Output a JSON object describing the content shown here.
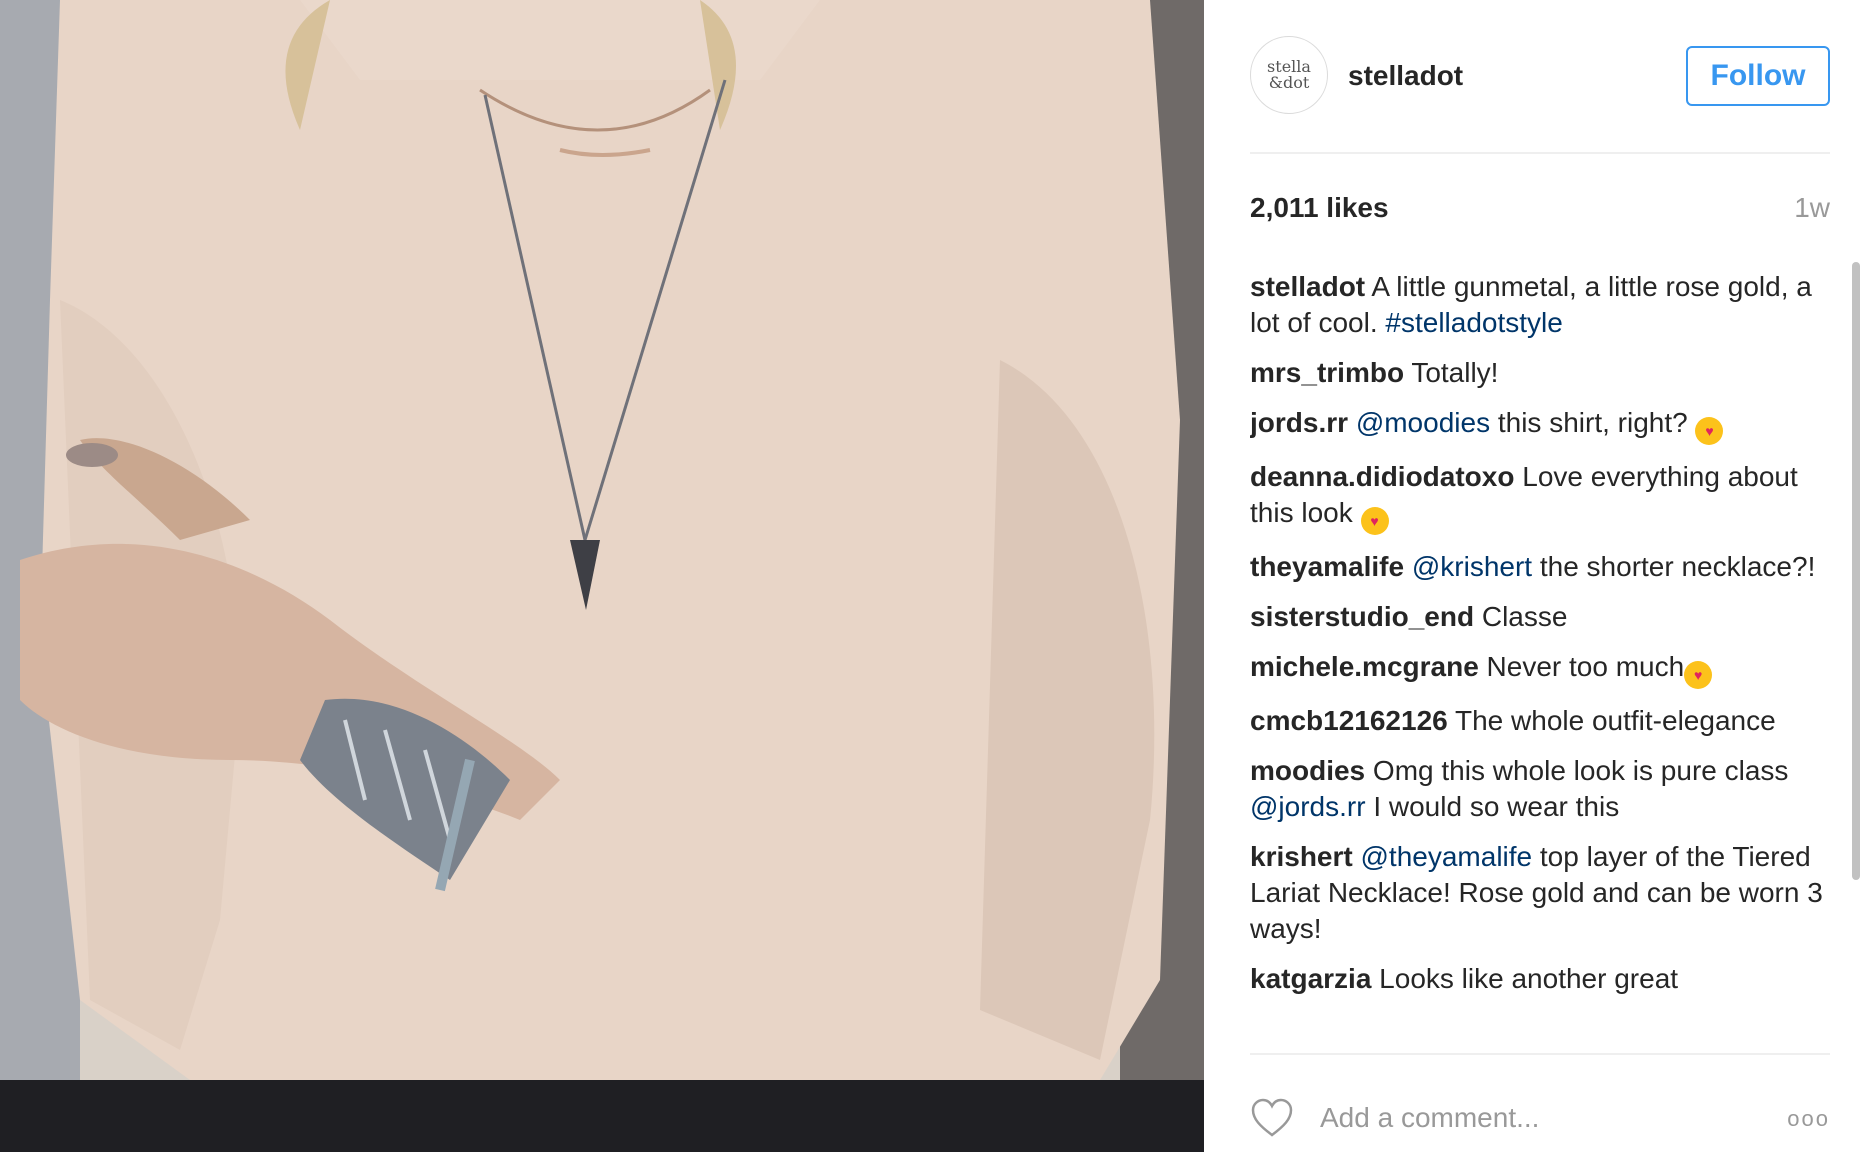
{
  "post": {
    "image_alt": "Woman in blush blouse wearing layered necklaces and wrap bracelets",
    "author": {
      "username": "stelladot",
      "avatar_text_line1": "stella",
      "avatar_text_line2": "&dot"
    },
    "follow_label": "Follow",
    "likes": "2,011 likes",
    "age": "1w"
  },
  "comments": [
    {
      "author": "stelladot",
      "text": " A little gunmetal, a little rose gold, a lot of cool. ",
      "hashtag": "#stelladotstyle"
    },
    {
      "author": "mrs_trimbo",
      "text": " Totally!"
    },
    {
      "author": "jords.rr",
      "mention": "@moodies",
      "text": " this shirt, right? ",
      "emoji": "heart-eyes"
    },
    {
      "author": "deanna.didiodatoxo",
      "text": " Love everything about this look ",
      "emoji": "heart-eyes"
    },
    {
      "author": "theyamalife",
      "mention": "@krishert",
      "text": " the shorter necklace?!"
    },
    {
      "author": "sisterstudio_end",
      "text": " Classe"
    },
    {
      "author": "michele.mcgrane",
      "text": " Never too much",
      "emoji": "kissing-heart"
    },
    {
      "author": "cmcb12162126",
      "text": " The whole outfit-elegance"
    },
    {
      "author": "moodies",
      "text": " Omg this whole look is pure class ",
      "mention": "@jords.rr",
      "text2": " I would so wear this"
    },
    {
      "author": "krishert",
      "mention": "@theyamalife",
      "text": " top layer of the Tiered Lariat Necklace! Rose gold and can be worn 3 ways!"
    },
    {
      "author": "katgarzia",
      "text": " Looks like another great"
    }
  ],
  "footer": {
    "comment_placeholder": "Add a comment...",
    "more_label": "ooo"
  },
  "colors": {
    "accent": "#3897f0",
    "mention": "#003569",
    "text": "#262626",
    "muted": "#999999"
  },
  "icons": {
    "like": "heart-outline-icon",
    "more": "more-options-icon"
  }
}
